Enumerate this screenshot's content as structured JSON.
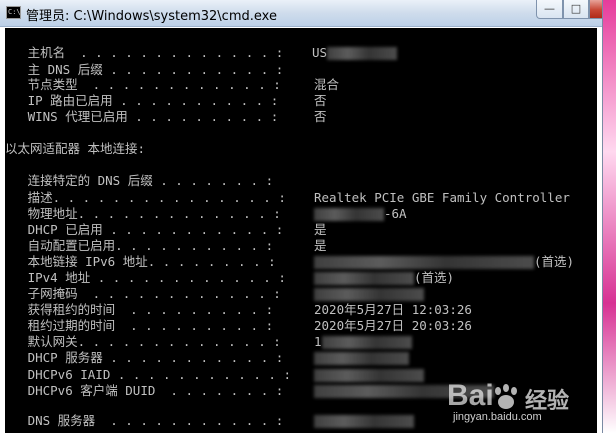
{
  "window": {
    "title": "管理员: C:\\Windows\\system32\\cmd.exe",
    "icon_glyph": "C:\\",
    "minimize_glyph": "—",
    "maximize_glyph": "□",
    "close_glyph": "✕"
  },
  "console": {
    "host_lines": [
      {
        "label": "   主机名  . . . . . . . . . . . . . :",
        "value": "US"
      },
      {
        "label": "   主 DNS 后缀 . . . . . . . . . . . :",
        "value": ""
      },
      {
        "label": "   节点类型  . . . . . . . . . . . . :",
        "value": "混合"
      },
      {
        "label": "   IP 路由已启用 . . . . . . . . . . :",
        "value": "否"
      },
      {
        "label": "   WINS 代理已启用 . . . . . . . . . :",
        "value": "否"
      }
    ],
    "adapter_header": "以太网适配器 本地连接:",
    "adapter_lines": [
      {
        "label": "   连接特定的 DNS 后缀 . . . . . . . :",
        "value": ""
      },
      {
        "label": "   描述. . . . . . . . . . . . . . . :",
        "value": "Realtek PCIe GBE Family Controller"
      },
      {
        "label": "   物理地址. . . . . . . . . . . . . :",
        "value": "-6A"
      },
      {
        "label": "   DHCP 已启用 . . . . . . . . . . . :",
        "value": "是"
      },
      {
        "label": "   自动配置已启用. . . . . . . . . . :",
        "value": "是"
      },
      {
        "label": "   本地链接 IPv6 地址. . . . . . . . :",
        "value": "(首选)"
      },
      {
        "label": "   IPv4 地址 . . . . . . . . . . . . :",
        "value": "(首选)"
      },
      {
        "label": "   子网掩码  . . . . . . . . . . . . :",
        "value": ""
      },
      {
        "label": "   获得租约的时间  . . . . . . . . . :",
        "value": "2020年5月27日 12:03:26"
      },
      {
        "label": "   租约过期的时间  . . . . . . . . . :",
        "value": "2020年5月27日 20:03:26"
      },
      {
        "label": "   默认网关. . . . . . . . . . . . . :",
        "value": "1"
      },
      {
        "label": "   DHCP 服务器 . . . . . . . . . . . :",
        "value": ""
      },
      {
        "label": "   DHCPv6 IAID . . . . . . . . . . . :",
        "value": ""
      },
      {
        "label": "   DHCPv6 客户端 DUID  . . . . . . . :",
        "value": ""
      }
    ],
    "dns_line": {
      "label": "   DNS 服务器  . . . . . . . . . . . :",
      "value": ""
    }
  },
  "watermark": {
    "brand": "Bai",
    "brand_cn": "经验",
    "url": "jingyan.baidu.com"
  },
  "colors": {
    "console_bg": "#000000",
    "console_fg": "#c0c0c0",
    "titlebar": "#cfdcec",
    "close_button": "#c74735"
  }
}
